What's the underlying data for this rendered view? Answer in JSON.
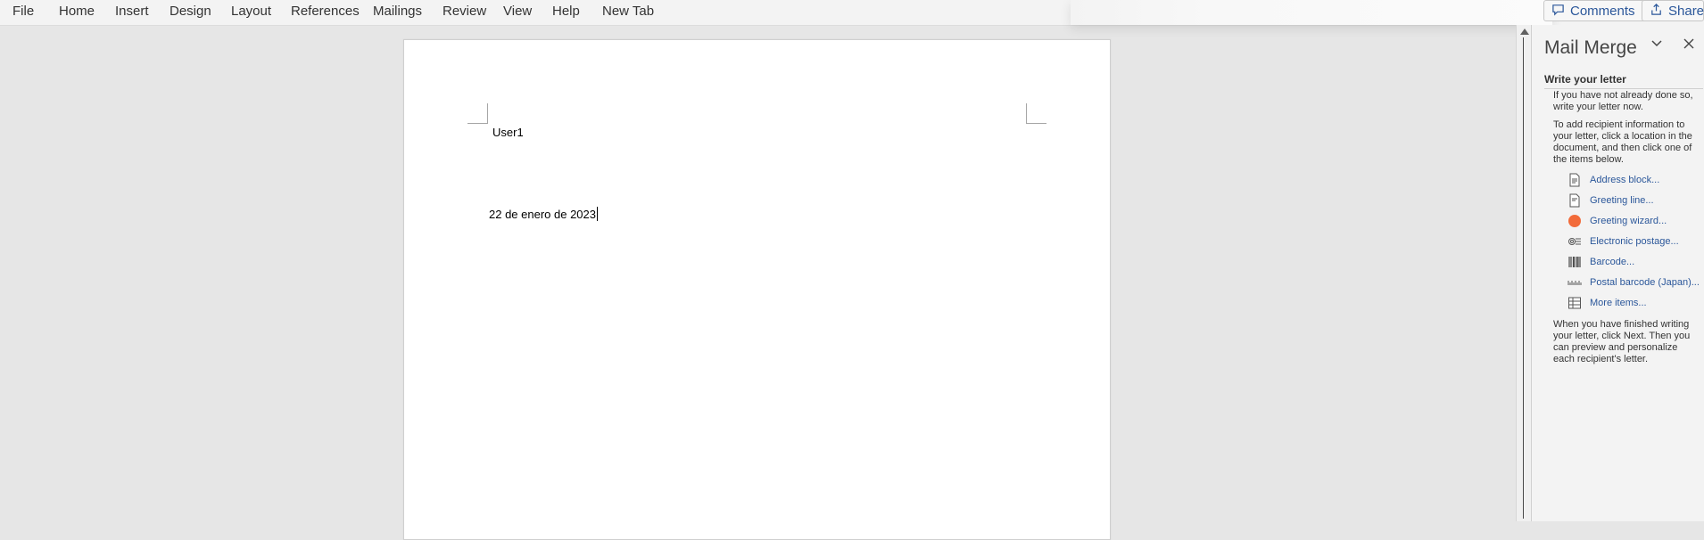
{
  "menu": [
    "File",
    "Home",
    "Insert",
    "Design",
    "Layout",
    "References",
    "Mailings",
    "Review",
    "View",
    "Help",
    "New Tab"
  ],
  "header_buttons": {
    "comments": "Comments",
    "share": "Share"
  },
  "document": {
    "name_line": "User1",
    "date_line": "22 de enero de 2023"
  },
  "pane": {
    "title": "Mail Merge",
    "section": "Write your letter",
    "intro": "If you have not already done so, write your letter now.",
    "instructions": "To add recipient information to your letter, click a location in the document, and then click one of the items below.",
    "links": [
      {
        "label": "Address block...",
        "icon": "address-block-icon"
      },
      {
        "label": "Greeting line...",
        "icon": "greeting-line-icon"
      },
      {
        "label": "Greeting wizard...",
        "icon": "greeting-wizard-icon"
      },
      {
        "label": "Electronic postage...",
        "icon": "electronic-postage-icon"
      },
      {
        "label": "Barcode...",
        "icon": "barcode-icon"
      },
      {
        "label": "Postal barcode (Japan)...",
        "icon": "postal-barcode-icon"
      },
      {
        "label": "More items...",
        "icon": "more-items-icon"
      }
    ],
    "footer": "When you have finished writing your letter, click Next. Then you can preview and personalize each recipient's letter."
  },
  "colors": {
    "link": "#2b579a",
    "accent_dot": "#f26b3a",
    "workspace": "#e6e6e6"
  }
}
